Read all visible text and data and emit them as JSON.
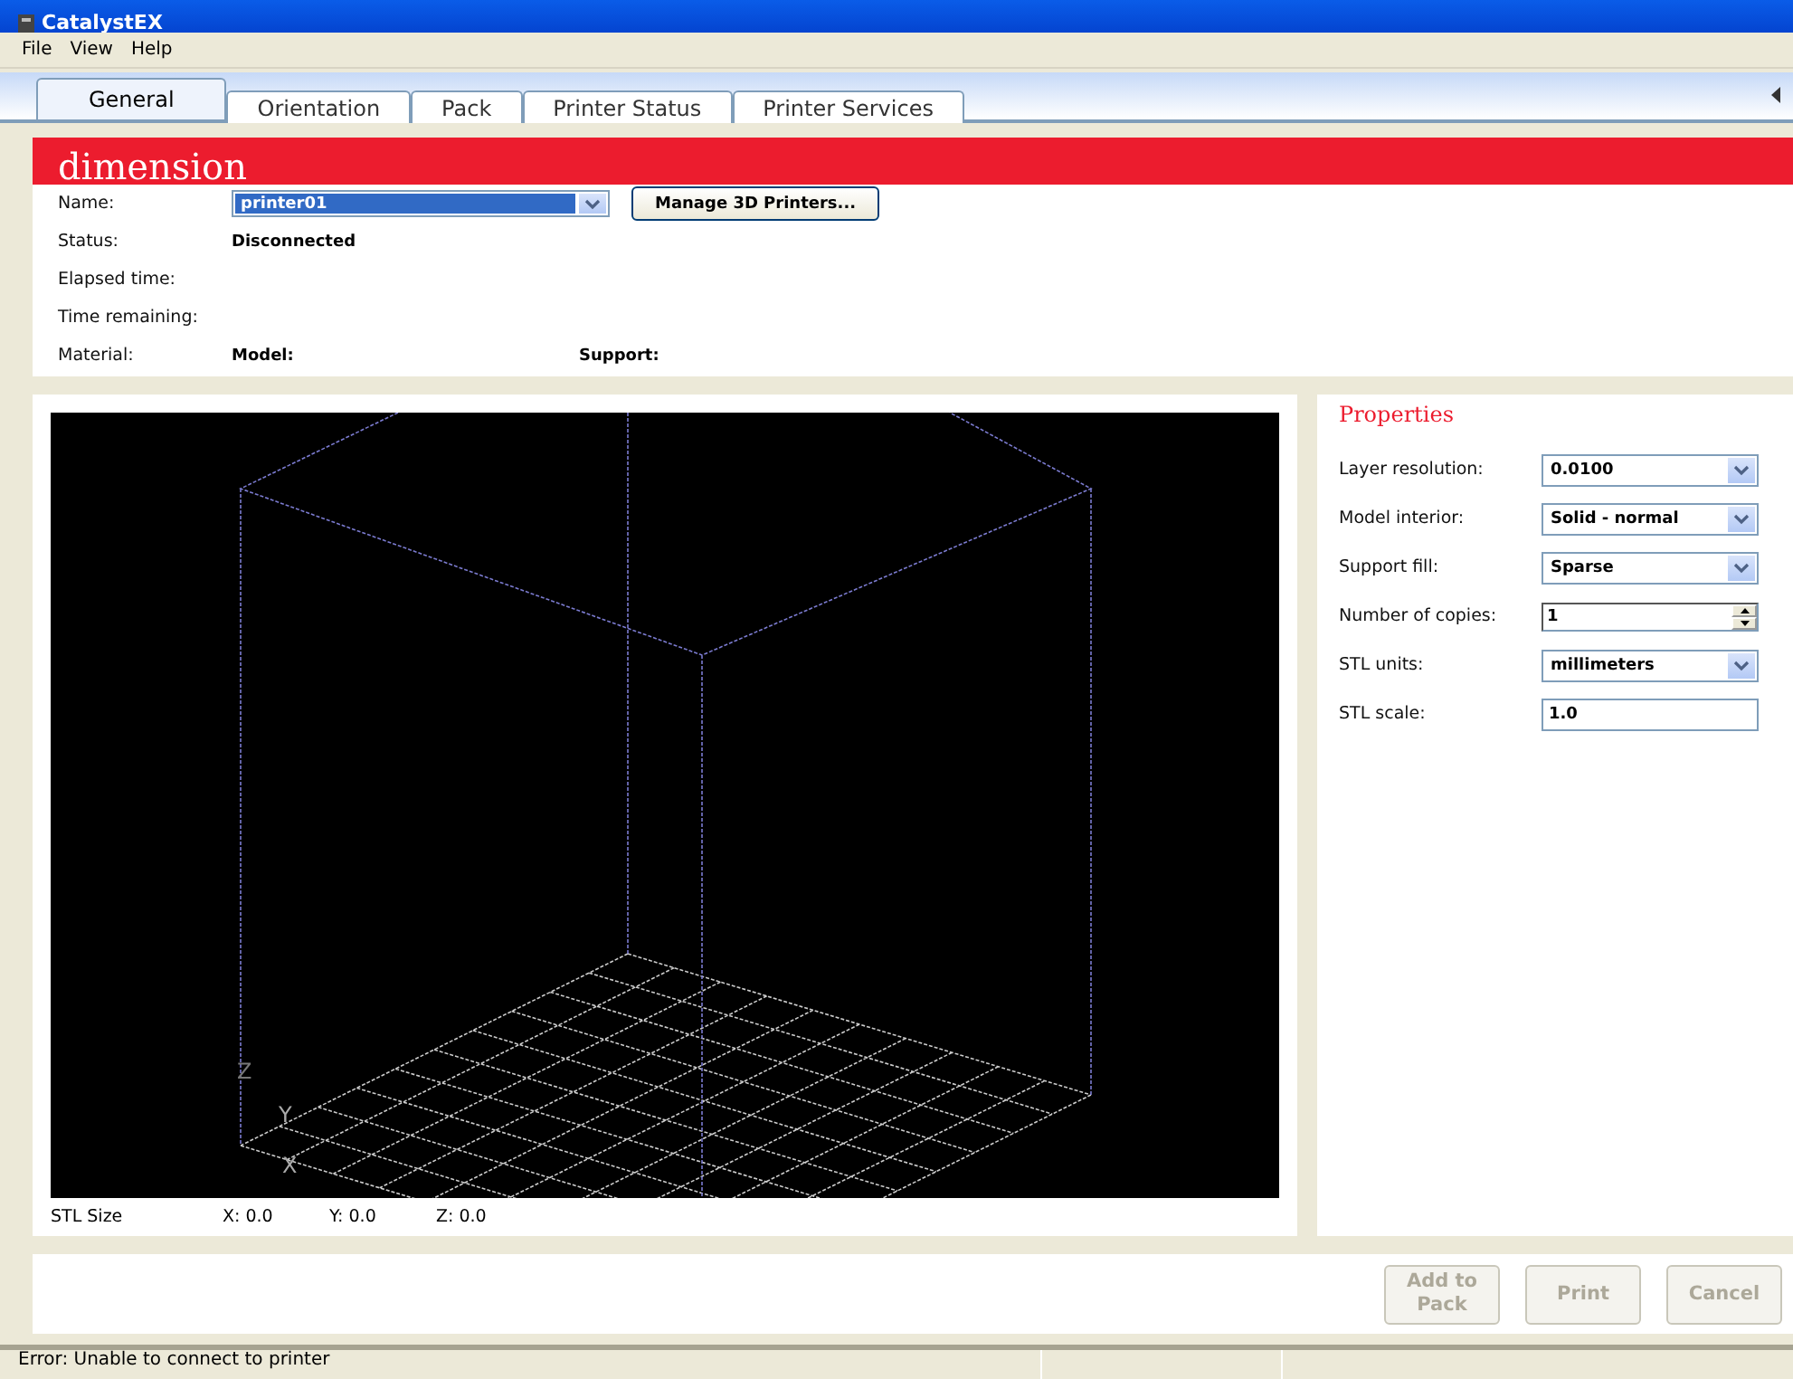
{
  "window": {
    "title": "CatalystEX"
  },
  "menu": [
    "File",
    "View",
    "Help"
  ],
  "tabs": [
    {
      "label": "General",
      "selected": true
    },
    {
      "label": "Orientation",
      "selected": false
    },
    {
      "label": "Pack",
      "selected": false
    },
    {
      "label": "Printer Status",
      "selected": false
    },
    {
      "label": "Printer Services",
      "selected": false
    }
  ],
  "banner": {
    "logo": "dimension"
  },
  "printer": {
    "name_label": "Name:",
    "name_value": "printer01",
    "manage_button": "Manage 3D Printers...",
    "status_label": "Status:",
    "status_value": "Disconnected",
    "elapsed_label": "Elapsed time:",
    "remaining_label": "Time remaining:",
    "material_label": "Material:",
    "model_label": "Model:",
    "support_label": "Support:"
  },
  "viewer": {
    "axes": [
      "Z",
      "Y",
      "X"
    ],
    "size_label": "STL Size",
    "x": "X:  0.0",
    "y": "Y:  0.0",
    "z": "Z:  0.0"
  },
  "properties": {
    "title": "Properties",
    "fields": [
      {
        "label": "Layer resolution:",
        "value": "0.0100",
        "kind": "select"
      },
      {
        "label": "Model interior:",
        "value": "Solid - normal",
        "kind": "select"
      },
      {
        "label": "Support fill:",
        "value": "Sparse",
        "kind": "select"
      },
      {
        "label": "Number of copies:",
        "value": "1",
        "kind": "spin"
      },
      {
        "label": "STL units:",
        "value": "millimeters",
        "kind": "select"
      },
      {
        "label": "STL scale:",
        "value": "1.0",
        "kind": "text"
      }
    ]
  },
  "buttons": [
    {
      "label": "Add to Pack",
      "disabled": true
    },
    {
      "label": "Print",
      "disabled": true
    },
    {
      "label": "Cancel",
      "disabled": true
    }
  ],
  "status_bar": {
    "message": "Error: Unable to connect to printer"
  }
}
